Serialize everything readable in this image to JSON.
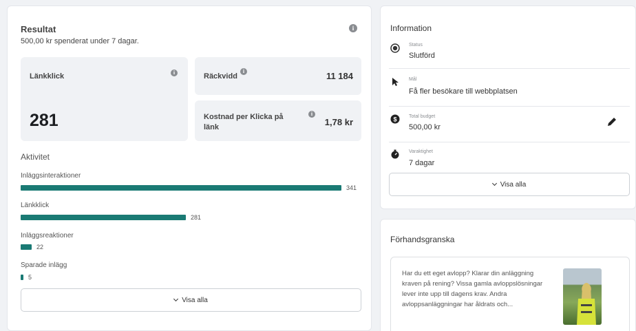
{
  "result": {
    "title": "Resultat",
    "subtitle": "500,00 kr spenderat under 7 dagar.",
    "metrics": {
      "link_clicks": {
        "label": "Länkklick",
        "value": "281"
      },
      "reach": {
        "label": "Räckvidd",
        "value": "11 184"
      },
      "cost": {
        "label": "Kostnad per Klicka på länk",
        "value": "1,78 kr"
      }
    },
    "activity_title": "Aktivitet",
    "activity": [
      {
        "label": "Inläggsinteraktioner",
        "value": "341",
        "fraction": 1.0
      },
      {
        "label": "Länkklick",
        "value": "281",
        "fraction": 0.514
      },
      {
        "label": "Inläggsreaktioner",
        "value": "22",
        "fraction": 0.034
      },
      {
        "label": "Sparade inlägg",
        "value": "5",
        "fraction": 0.006
      }
    ],
    "show_all": "Visa alla"
  },
  "information": {
    "title": "Information",
    "rows": [
      {
        "icon": "status-radio-icon",
        "label": "Status",
        "value": "Slutförd"
      },
      {
        "icon": "cursor-arrow-icon",
        "label": "Mål",
        "value": "Få fler besökare till webbplatsen"
      },
      {
        "icon": "budget-coin-icon",
        "label": "Total budget",
        "value": "500,00 kr"
      },
      {
        "icon": "stopwatch-icon",
        "label": "Varaktighet",
        "value": "7 dagar"
      }
    ],
    "show_all": "Visa alla"
  },
  "preview": {
    "title": "Förhandsgranska",
    "post_text": "Har du ett eget avlopp? Klarar din anläggning kraven på rening? Vissa gamla avloppslösningar lever inte upp till dagens krav. Andra avloppsanläggningar har åldrats och..."
  },
  "colors": {
    "bar": "#1a7a74",
    "card": "#ffffff",
    "metric_bg": "#f0f2f5"
  }
}
